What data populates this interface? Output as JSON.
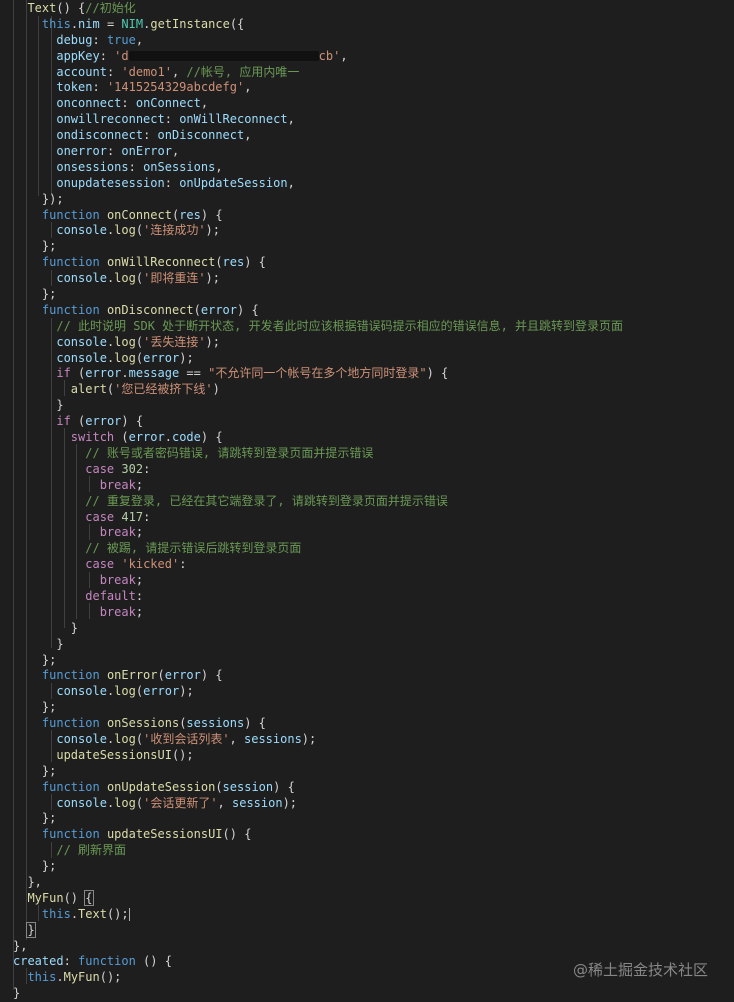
{
  "code": {
    "text_fn_name": "Text",
    "text_fn_comment": "//初始化",
    "nim_class": "NIM",
    "get_instance": "getInstance",
    "debug_value": "true",
    "appkey_prefix": "'d",
    "appkey_suffix": "cb'",
    "account_value": "'demo1'",
    "account_comment": "//帐号, 应用内唯一",
    "token_value": "'1415254329abcdefg'",
    "props": [
      "debug",
      "appKey",
      "account",
      "token",
      "onconnect",
      "onwillreconnect",
      "ondisconnect",
      "onerror",
      "onsessions",
      "onupdatesession"
    ],
    "handlers": [
      "onConnect",
      "onWillReconnect",
      "onDisconnect",
      "onError",
      "onSessions",
      "onUpdateSession"
    ],
    "log_connected": "'连接成功'",
    "log_will_reconnect": "'即将重连'",
    "comment_disconnect": "// 此时说明 SDK 处于断开状态, 开发者此时应该根据错误码提示相应的错误信息, 并且跳转到登录页面",
    "log_lost": "'丢失连接'",
    "error_message_str": "\"不允许同一个帐号在多个地方同时登录\"",
    "alert_str": "'您已经被挤下线'",
    "comment_302": "// 账号或者密码错误, 请跳转到登录页面并提示错误",
    "case_302": "302",
    "comment_417": "// 重复登录, 已经在其它端登录了, 请跳转到登录页面并提示错误",
    "case_417": "417",
    "comment_kicked": "// 被踢, 请提示错误后跳转到登录页面",
    "case_kicked": "'kicked'",
    "log_sessions": "'收到会话列表'",
    "log_update_session": "'会话更新了'",
    "comment_refresh": "// 刷新界面",
    "myfun_name": "MyFun",
    "created_label": "created"
  },
  "watermark": "@稀土掘金技术社区"
}
